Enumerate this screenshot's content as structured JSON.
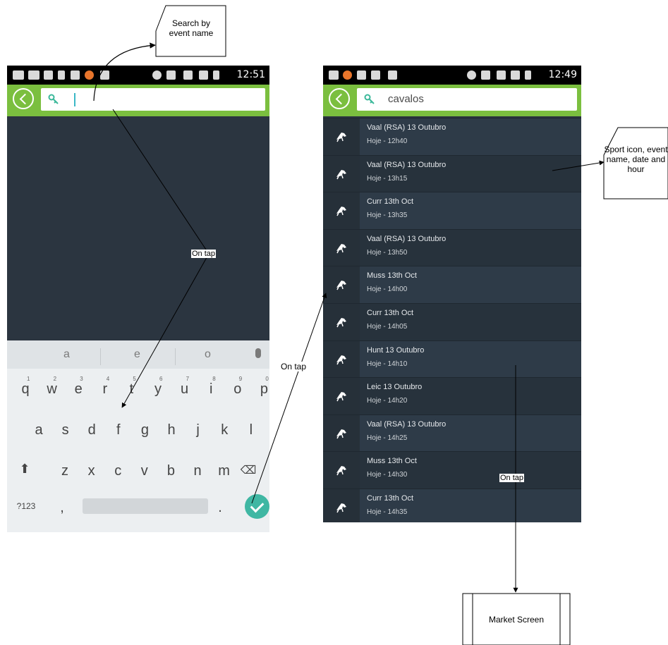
{
  "left_phone": {
    "status_time": "12:51",
    "search_value": "",
    "suggestions": [
      "a",
      "e",
      "o"
    ],
    "keyboard_rows": [
      [
        "q",
        "w",
        "e",
        "r",
        "t",
        "y",
        "u",
        "i",
        "o",
        "p"
      ],
      [
        "a",
        "s",
        "d",
        "f",
        "g",
        "h",
        "j",
        "k",
        "l"
      ],
      [
        "z",
        "x",
        "c",
        "v",
        "b",
        "n",
        "m"
      ]
    ],
    "numbers": [
      "1",
      "2",
      "3",
      "4",
      "5",
      "6",
      "7",
      "8",
      "9",
      "0"
    ],
    "mode_key": "?123",
    "comma_key": ",",
    "period_key": "."
  },
  "right_phone": {
    "status_time": "12:49",
    "search_value": "cavalos",
    "events": [
      {
        "name": "Vaal (RSA) 13 Outubro",
        "time": "Hoje - 12h40"
      },
      {
        "name": "Vaal (RSA) 13 Outubro",
        "time": "Hoje - 13h15"
      },
      {
        "name": "Curr 13th Oct",
        "time": "Hoje - 13h35"
      },
      {
        "name": "Vaal (RSA) 13 Outubro",
        "time": "Hoje - 13h50"
      },
      {
        "name": "Muss 13th Oct",
        "time": "Hoje - 14h00"
      },
      {
        "name": "Curr 13th Oct",
        "time": "Hoje - 14h05"
      },
      {
        "name": "Hunt 13 Outubro",
        "time": "Hoje - 14h10"
      },
      {
        "name": "Leic 13 Outubro",
        "time": "Hoje - 14h20"
      },
      {
        "name": "Vaal (RSA) 13 Outubro",
        "time": "Hoje - 14h25"
      },
      {
        "name": "Muss 13th Oct",
        "time": "Hoje - 14h30"
      },
      {
        "name": "Curr 13th Oct",
        "time": "Hoje - 14h35"
      }
    ],
    "row_colors": [
      "#2e3b48",
      "#27323c"
    ]
  },
  "annotations": {
    "search_note": "Search by event name",
    "sport_note": "Sport icon, event name, date and hour",
    "on_tap": "On tap",
    "market_screen": "Market Screen"
  }
}
